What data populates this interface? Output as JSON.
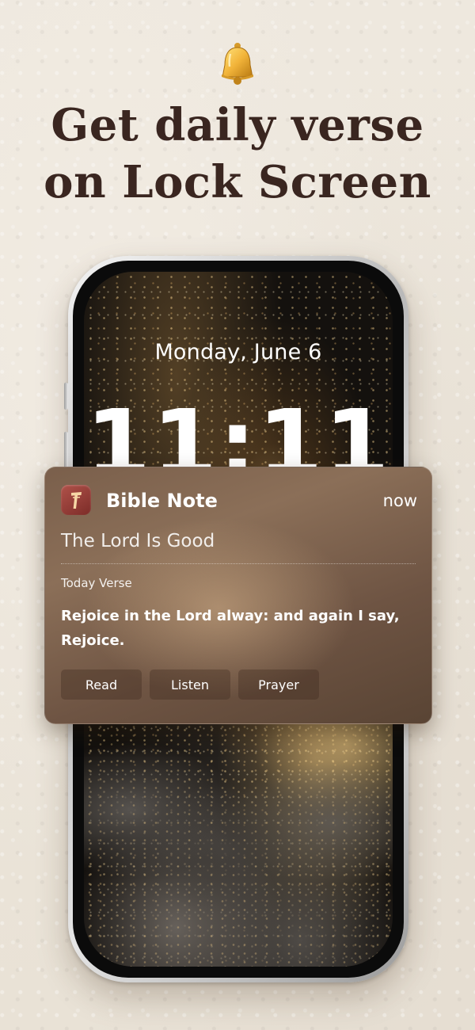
{
  "headline": {
    "line1": "Get daily verse",
    "line2": "on Lock Screen",
    "color": "#3a2620"
  },
  "icons": {
    "bell": "bell-icon",
    "app": "bible-note-app-icon"
  },
  "lock_screen": {
    "date": "Monday, June 6",
    "time": "11:11"
  },
  "notification": {
    "app_name": "Bible Note",
    "time": "now",
    "title": "The Lord Is Good",
    "label": "Today Verse",
    "verse": "Rejoice in the Lord alway: and again I say, Rejoice.",
    "actions": [
      {
        "label": "Read"
      },
      {
        "label": "Listen"
      },
      {
        "label": "Prayer"
      }
    ]
  },
  "colors": {
    "background": "#ece5da",
    "notification_tint": "#7a5f4b",
    "app_icon": "#9a3f38"
  }
}
